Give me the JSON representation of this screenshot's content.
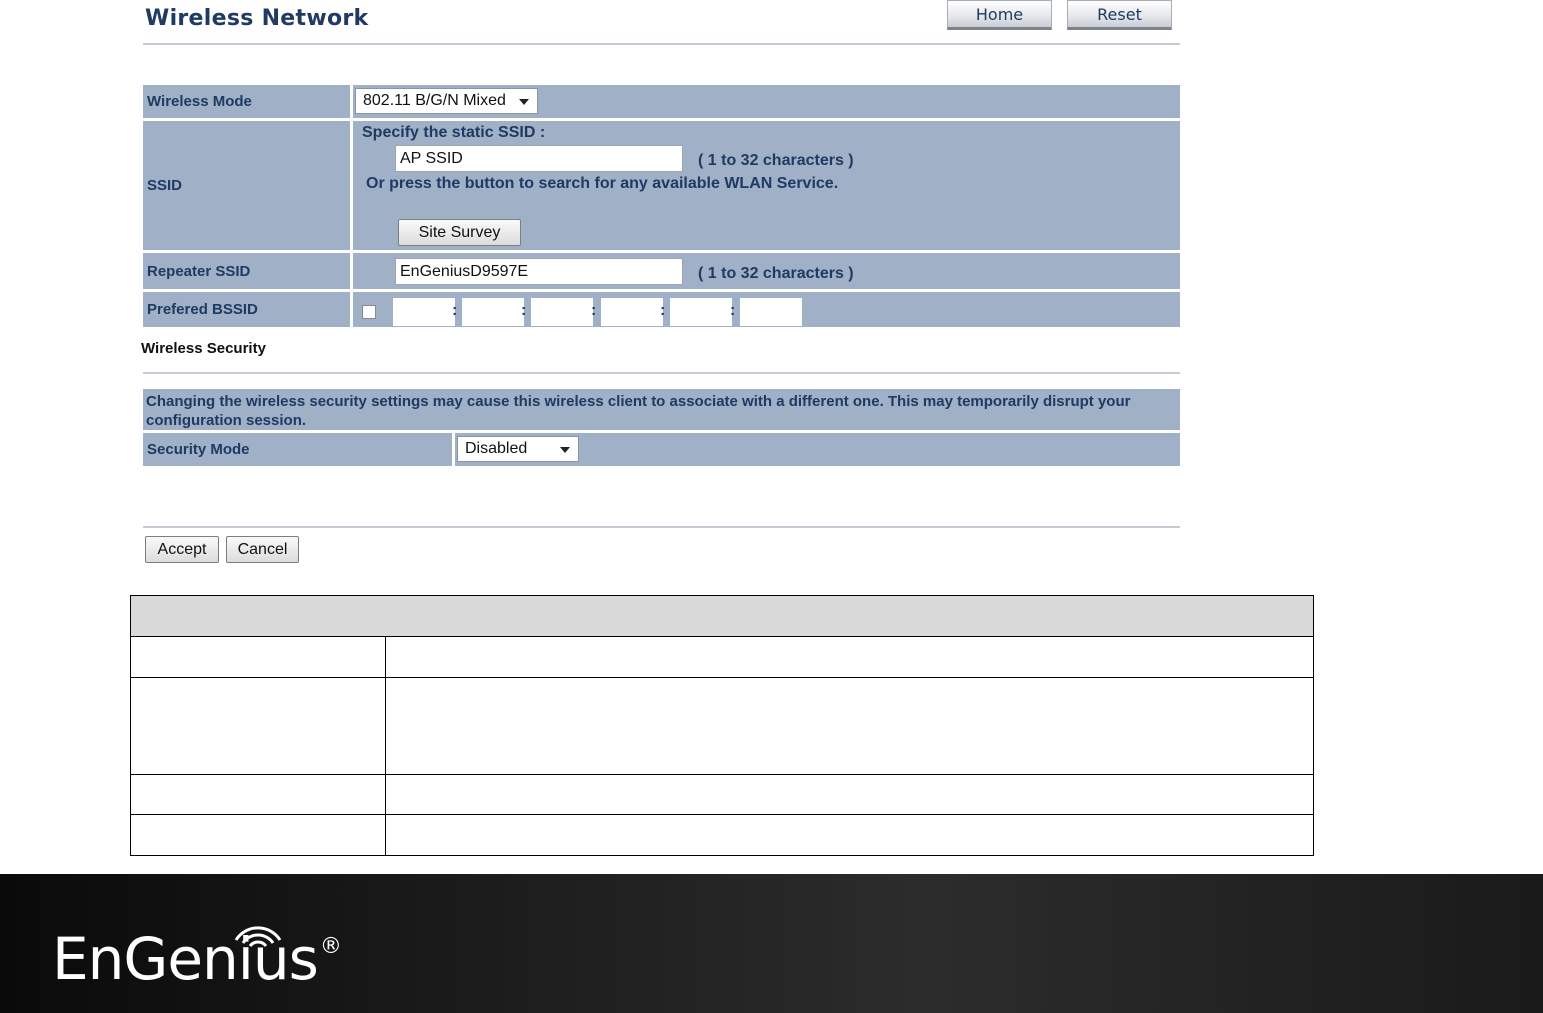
{
  "header": {
    "title": "Wireless Network",
    "home_label": "Home",
    "reset_label": "Reset"
  },
  "wireless_network": {
    "wireless_mode": {
      "label": "Wireless Mode",
      "value": "802.11 B/G/N Mixed"
    },
    "ssid": {
      "label": "SSID",
      "instruction": "Specify the static SSID  :",
      "value": "AP SSID",
      "hint": "( 1 to 32 characters )",
      "search_text": "Or press the button to search for any available WLAN Service.",
      "site_survey_label": "Site Survey"
    },
    "repeater_ssid": {
      "label": "Repeater SSID",
      "value": "EnGeniusD9597E",
      "hint": "( 1 to 32 characters )"
    },
    "prefered_bssid": {
      "label": "Prefered BSSID",
      "checked": false,
      "octets": [
        "",
        "",
        "",
        "",
        "",
        ""
      ]
    }
  },
  "wireless_security": {
    "heading": "Wireless Security",
    "notice": "Changing the wireless security settings may cause this wireless client to associate with a different one. This may temporarily disrupt your configuration session.",
    "security_mode": {
      "label": "Security Mode",
      "value": "Disabled"
    }
  },
  "actions": {
    "accept_label": "Accept",
    "cancel_label": "Cancel"
  },
  "footer": {
    "brand": "EnGenius",
    "reg_mark": "®",
    "wifi_icon": "wifi-arcs-icon"
  }
}
